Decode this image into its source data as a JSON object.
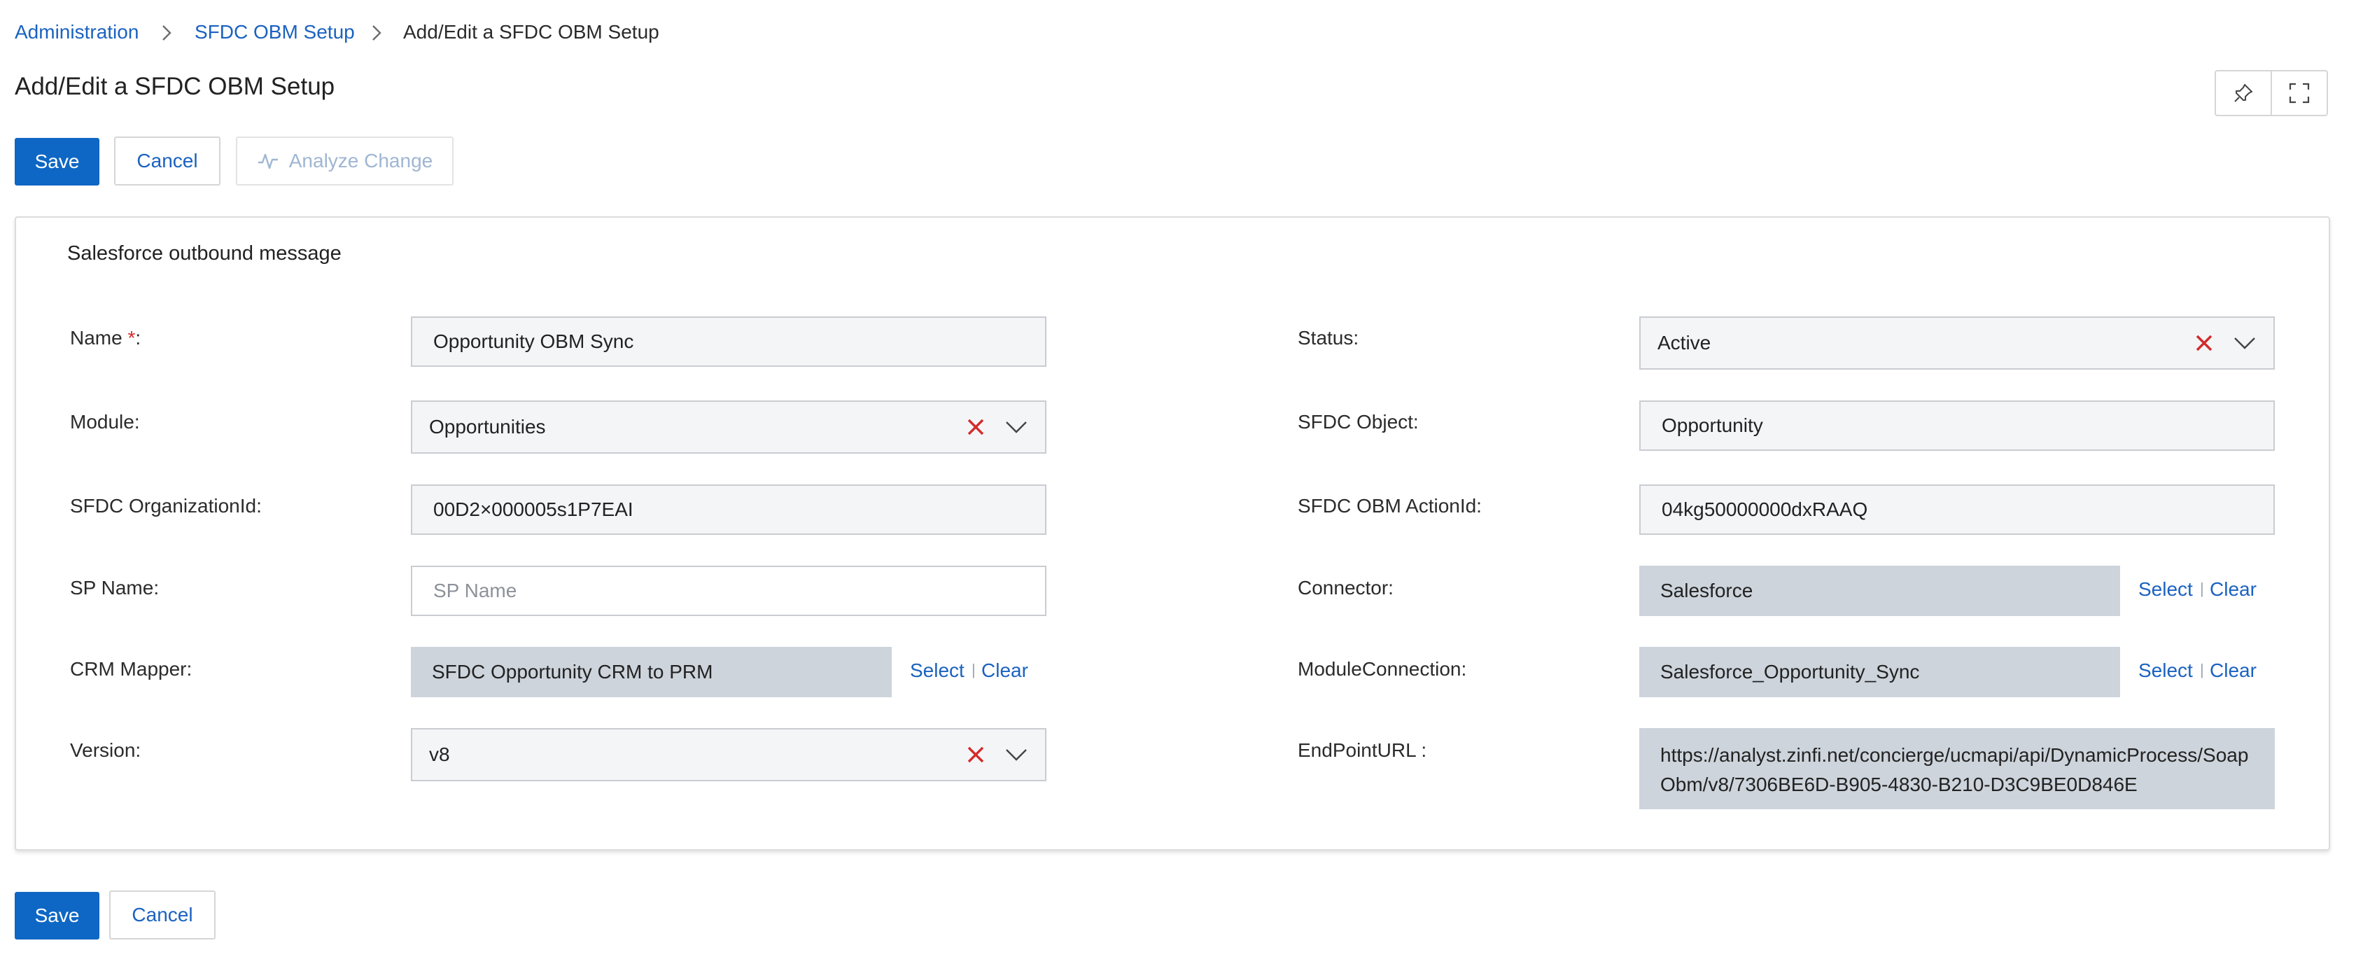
{
  "breadcrumb": {
    "items": [
      "Administration",
      "SFDC OBM Setup"
    ],
    "current": "Add/Edit a SFDC OBM Setup"
  },
  "page": {
    "title": "Add/Edit a SFDC OBM Setup"
  },
  "toolbar": {
    "save_label": "Save",
    "cancel_label": "Cancel",
    "analyze_label": "Analyze Change",
    "pin_icon": "pin-icon",
    "fullscreen_icon": "fullscreen-icon"
  },
  "section": {
    "title": "Salesforce outbound message"
  },
  "form": {
    "name": {
      "label": "Name",
      "required_mark": "*",
      "suffix": ":",
      "value": "Opportunity OBM Sync"
    },
    "module": {
      "label": "Module:",
      "value": "Opportunities"
    },
    "org_id": {
      "label": "SFDC OrganizationId:",
      "value": "00D2×000005s1P7EAI"
    },
    "sp_name": {
      "label": "SP Name:",
      "value": "",
      "placeholder": "SP Name"
    },
    "crm_mapper": {
      "label": "CRM Mapper:",
      "value": "SFDC Opportunity CRM to PRM"
    },
    "version": {
      "label": "Version:",
      "value": "v8"
    },
    "status": {
      "label": "Status:",
      "value": "Active"
    },
    "sfdc_object": {
      "label": "SFDC Object:",
      "value": "Opportunity"
    },
    "action_id": {
      "label": "SFDC OBM ActionId:",
      "value": "04kg50000000dxRAAQ"
    },
    "connector": {
      "label": "Connector:",
      "value": "Salesforce"
    },
    "module_connection": {
      "label": "ModuleConnection:",
      "value": "Salesforce_Opportunity_Sync"
    },
    "endpoint_url": {
      "label": "EndPointURL :",
      "value": "https://analyst.zinfi.net/concierge/ucmapi/api/DynamicProcess/SoapObm/v8/7306BE6D-B905-4830-B210-D3C9BE0D846E"
    },
    "select_label": "Select",
    "clear_label": "Clear",
    "pipe": "|"
  },
  "footer": {
    "save_label": "Save",
    "cancel_label": "Cancel"
  },
  "colors": {
    "accent": "#0e67c4",
    "link": "#1b62c0",
    "clear_x": "#d42a2a",
    "readonly_field": "#cdd4dc"
  }
}
